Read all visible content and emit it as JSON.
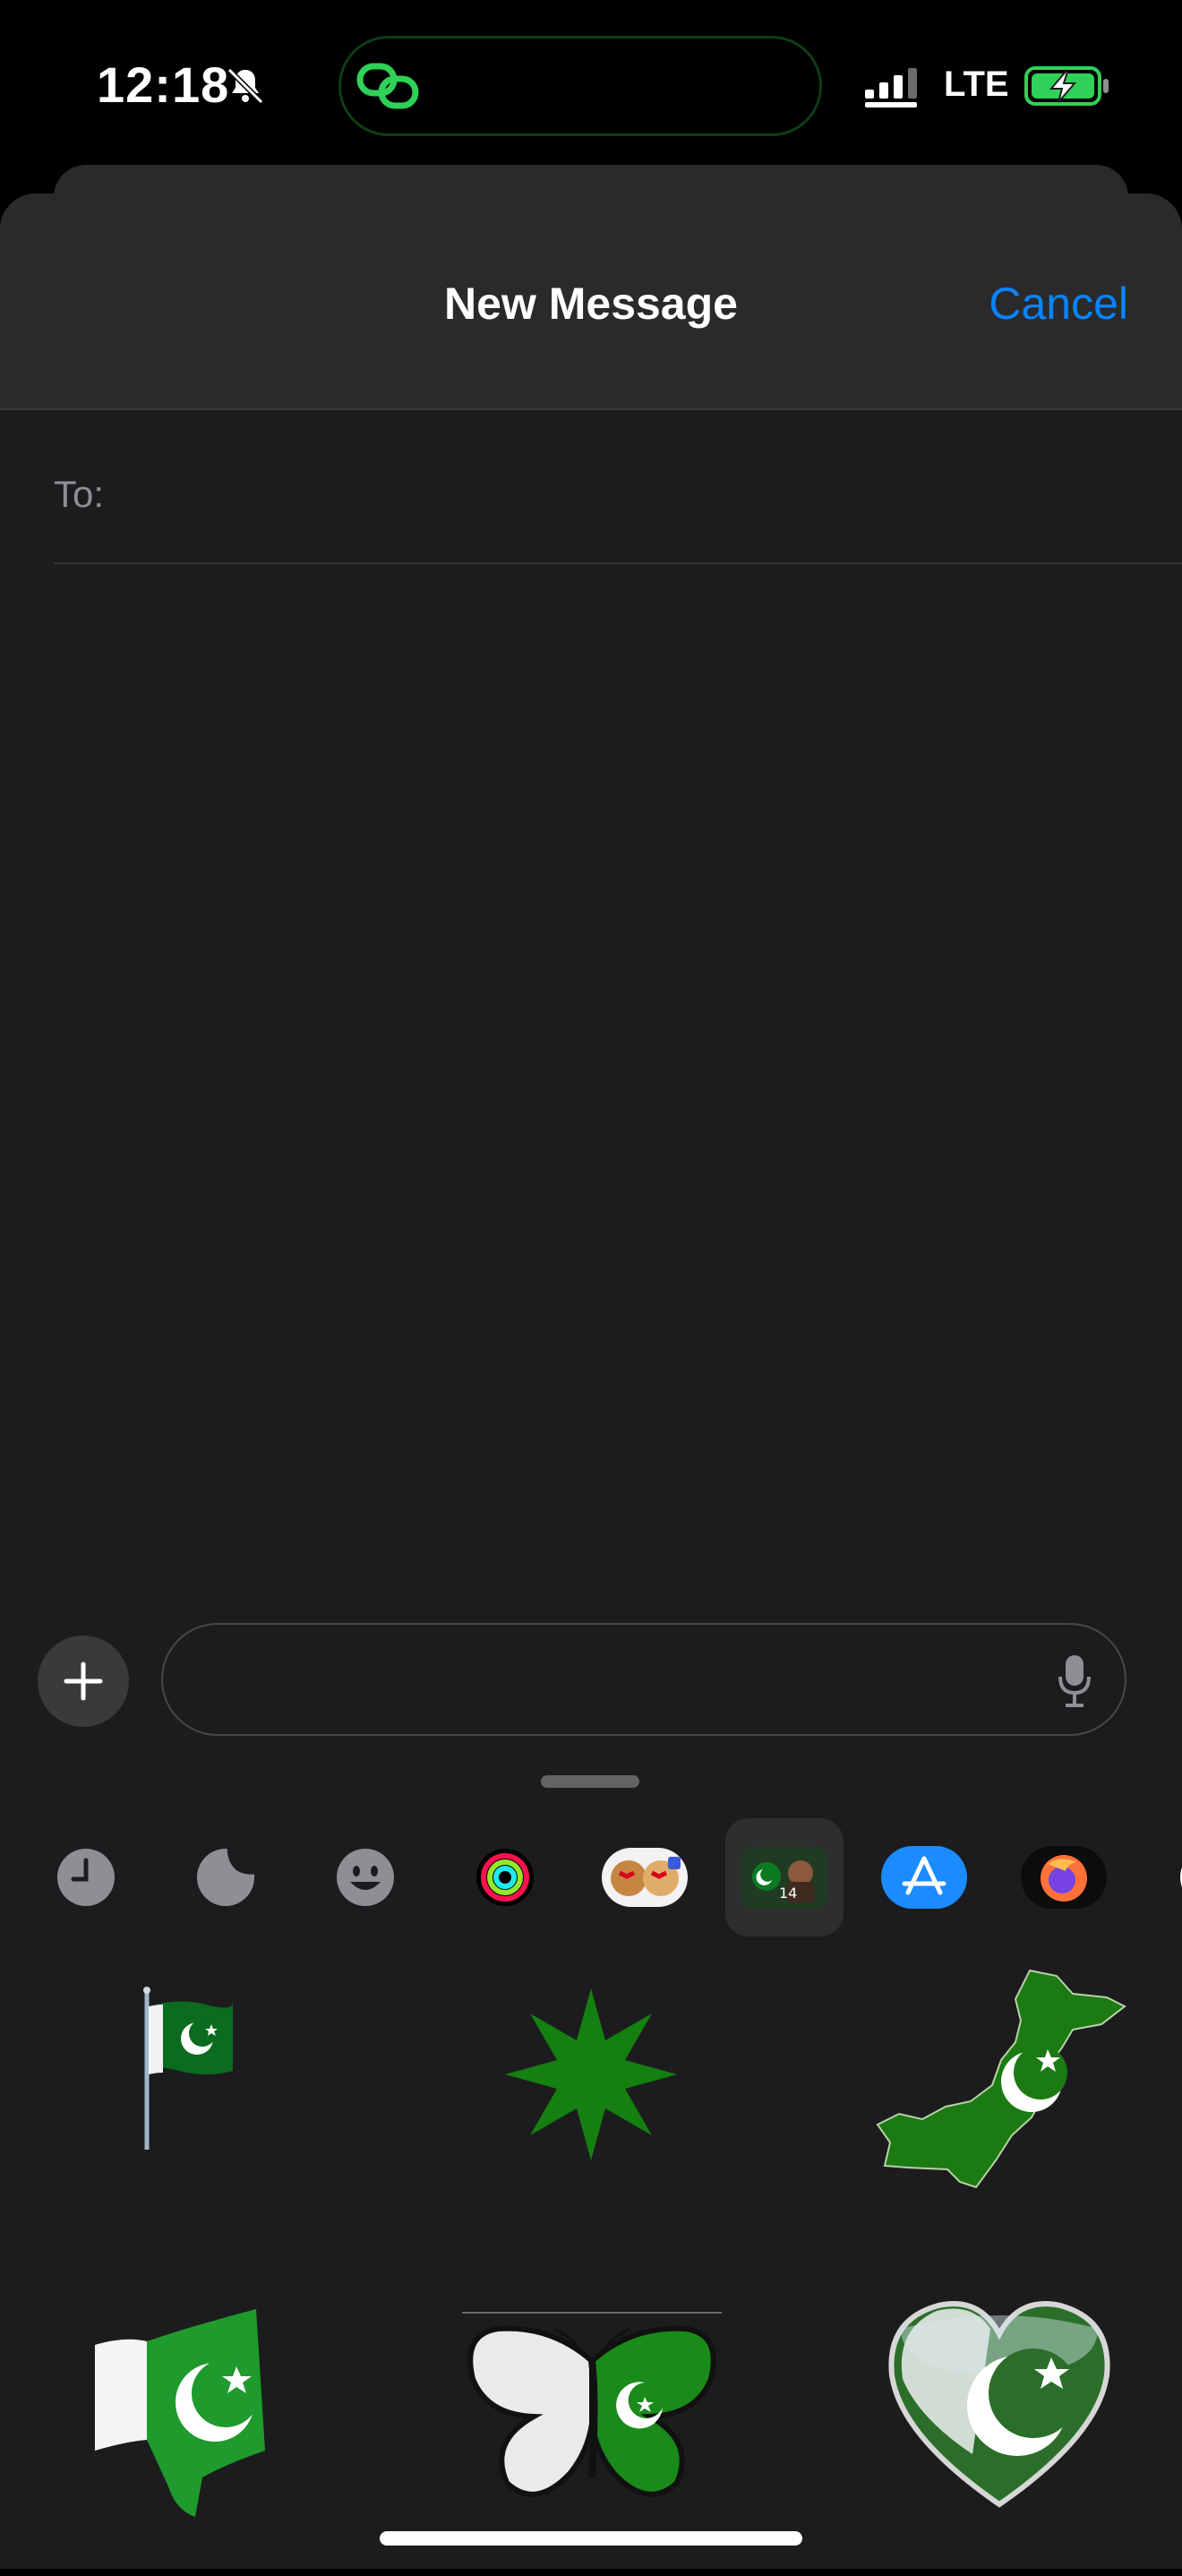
{
  "status_bar": {
    "time": "12:18",
    "network": "LTE"
  },
  "sheet": {
    "title": "New Message",
    "cancel_label": "Cancel",
    "to_label": "To:"
  },
  "composer": {
    "placeholder": ""
  },
  "app_strip": {
    "items": [
      {
        "name": "recents-icon"
      },
      {
        "name": "stickers-icon"
      },
      {
        "name": "emoji-icon"
      },
      {
        "name": "activity-icon"
      },
      {
        "name": "memoji-icon"
      },
      {
        "name": "pakistan-stickers-app-icon",
        "selected": true
      },
      {
        "name": "app-store-icon"
      },
      {
        "name": "firefox-icon"
      }
    ]
  },
  "stickers": [
    {
      "name": "pakistan-flag-on-pole-sticker"
    },
    {
      "name": "green-star-sticker"
    },
    {
      "name": "pakistan-map-sticker"
    },
    {
      "name": "waving-pakistan-flag-sticker"
    },
    {
      "name": "pakistan-butterfly-sticker"
    },
    {
      "name": "pakistan-heart-sticker"
    }
  ],
  "colors": {
    "accent": "#0a84ff",
    "sheet_bg": "#1c1c1e",
    "nav_bg": "#2a2a2c",
    "island_border": "#0f3d17",
    "flag_green": "#0b7a23"
  }
}
